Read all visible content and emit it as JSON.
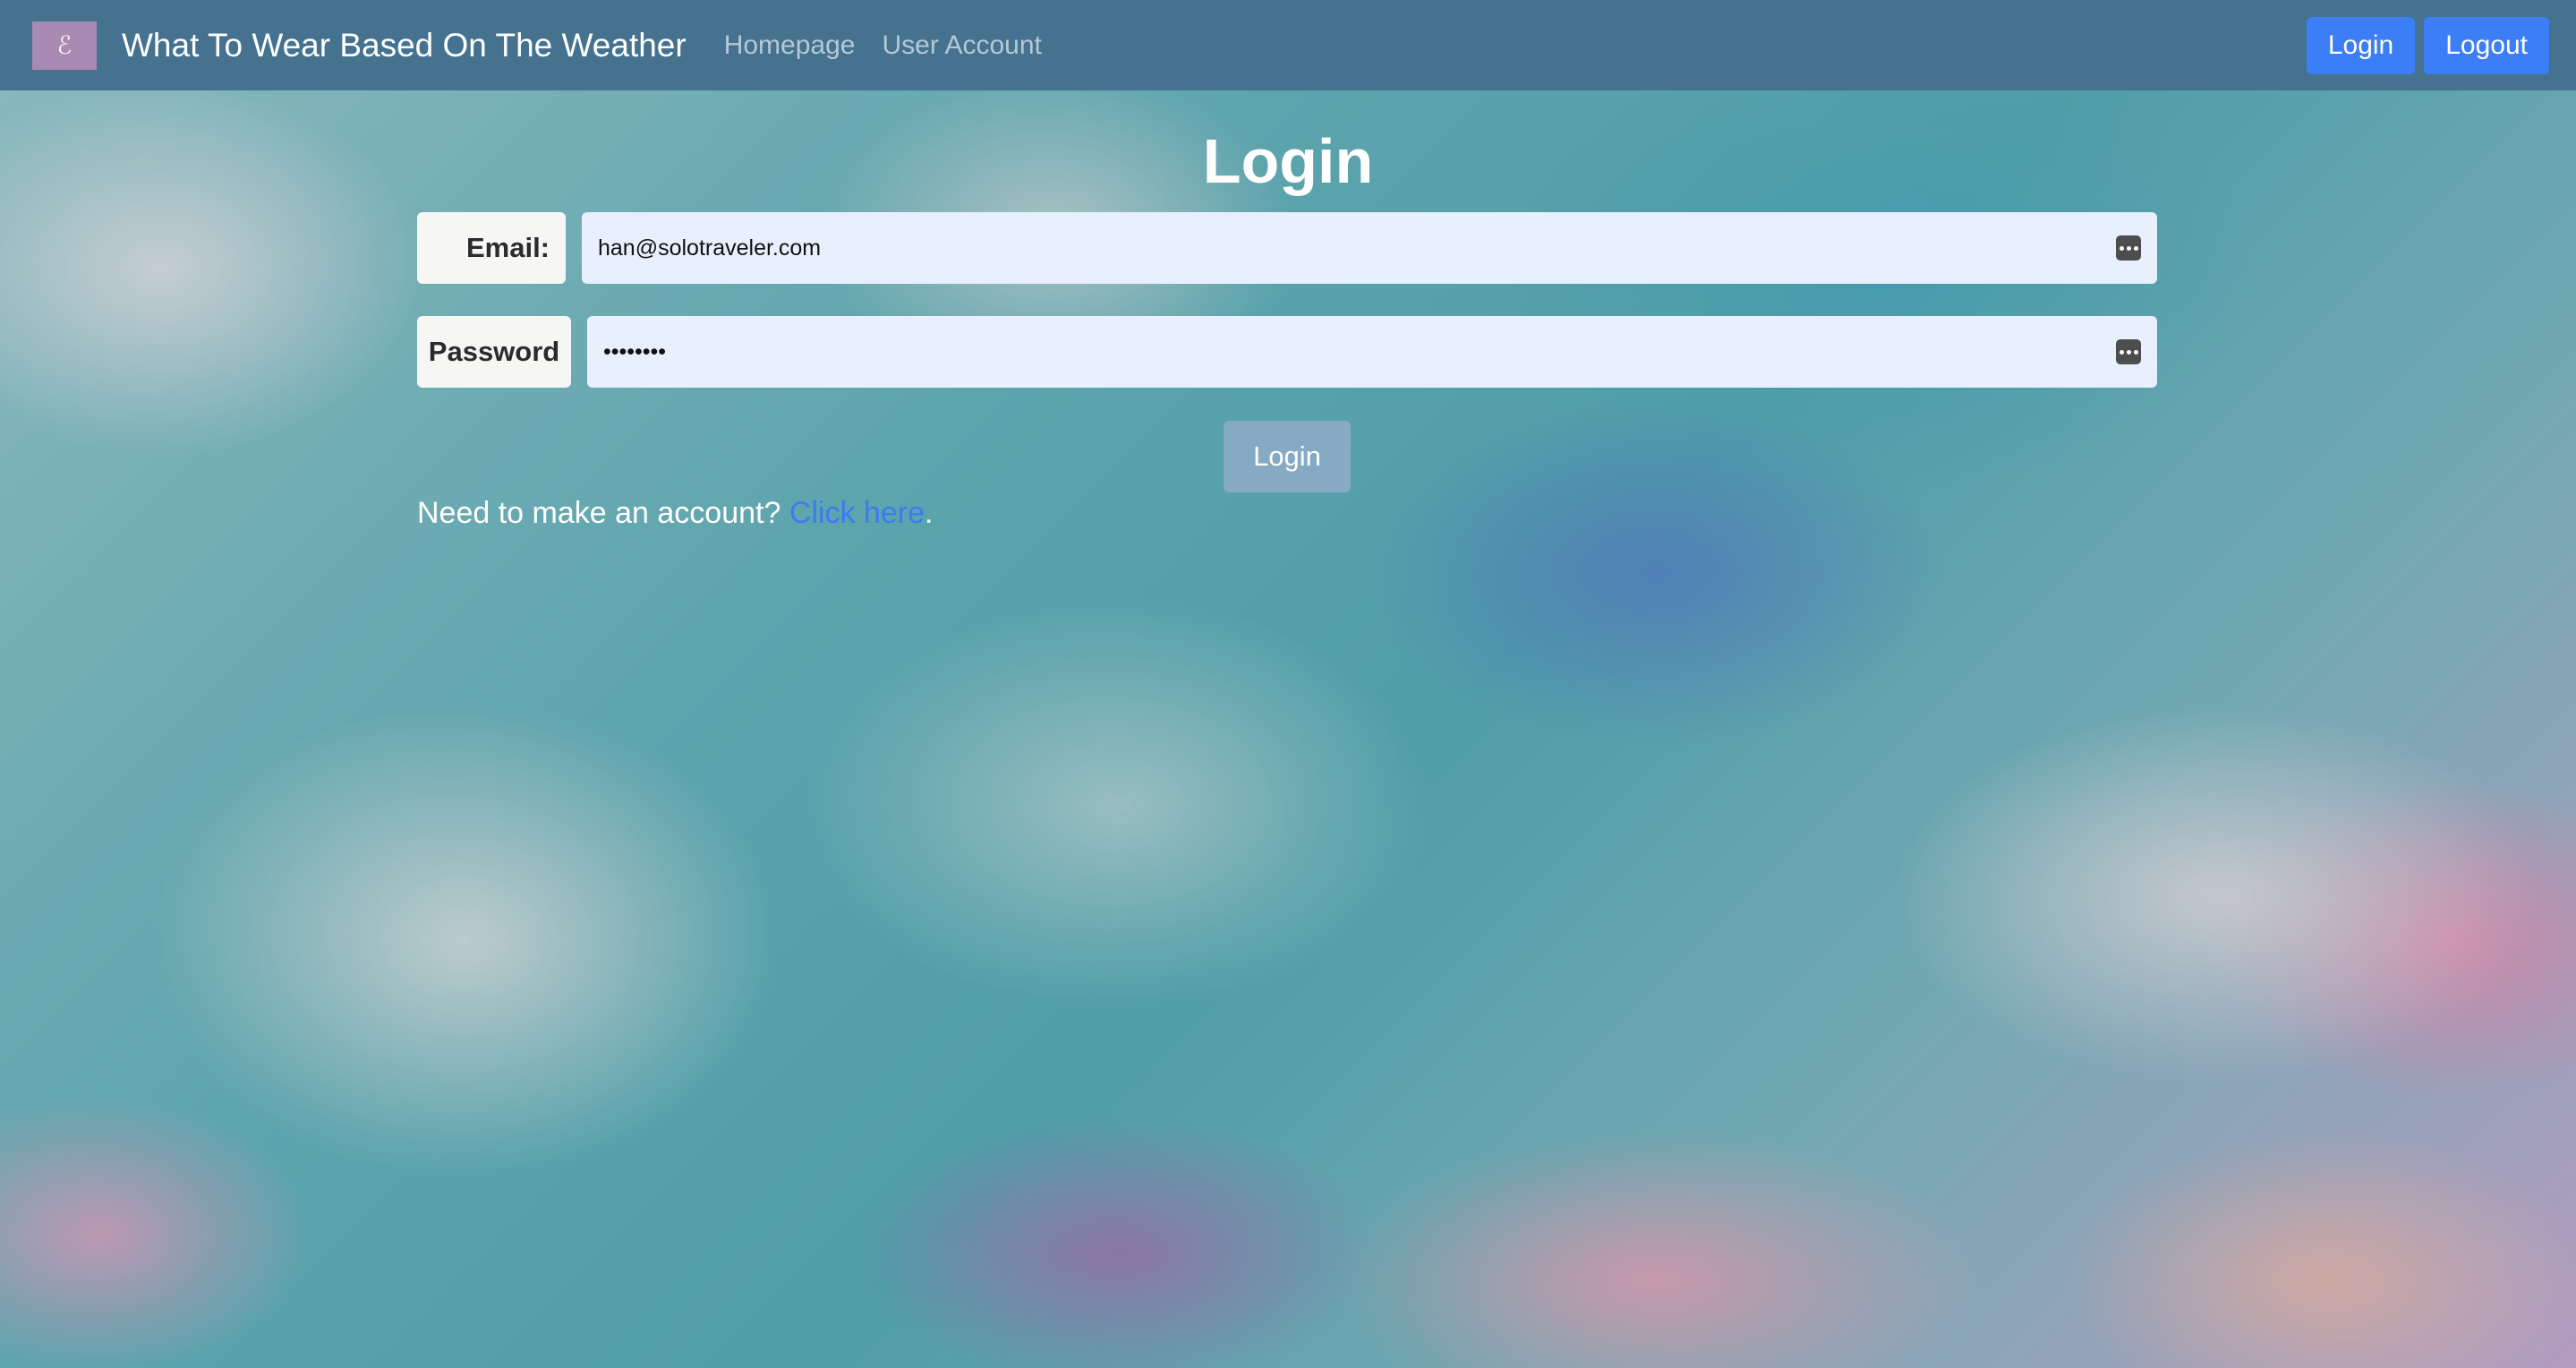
{
  "navbar": {
    "logo_glyph": "ℰ",
    "brand": "What To Wear Based On The Weather",
    "links": [
      "Homepage",
      "User Account"
    ],
    "login_button": "Login",
    "logout_button": "Logout"
  },
  "login": {
    "title": "Login",
    "email_label": "Email:",
    "email_value": "han@solotraveler.com",
    "password_label": "Password",
    "password_value": "••••••••",
    "submit_label": "Login",
    "signup_prompt": "Need to make an account?",
    "signup_link": "Click here",
    "signup_suffix": "."
  },
  "colors": {
    "navbar_bg": "#44728f",
    "primary_button": "#3b7ef5",
    "disabled_button": "#86a9c4",
    "input_bg": "#e9f0fd",
    "link": "#3a7cf2"
  },
  "icons": [
    "password-manager-icon"
  ]
}
